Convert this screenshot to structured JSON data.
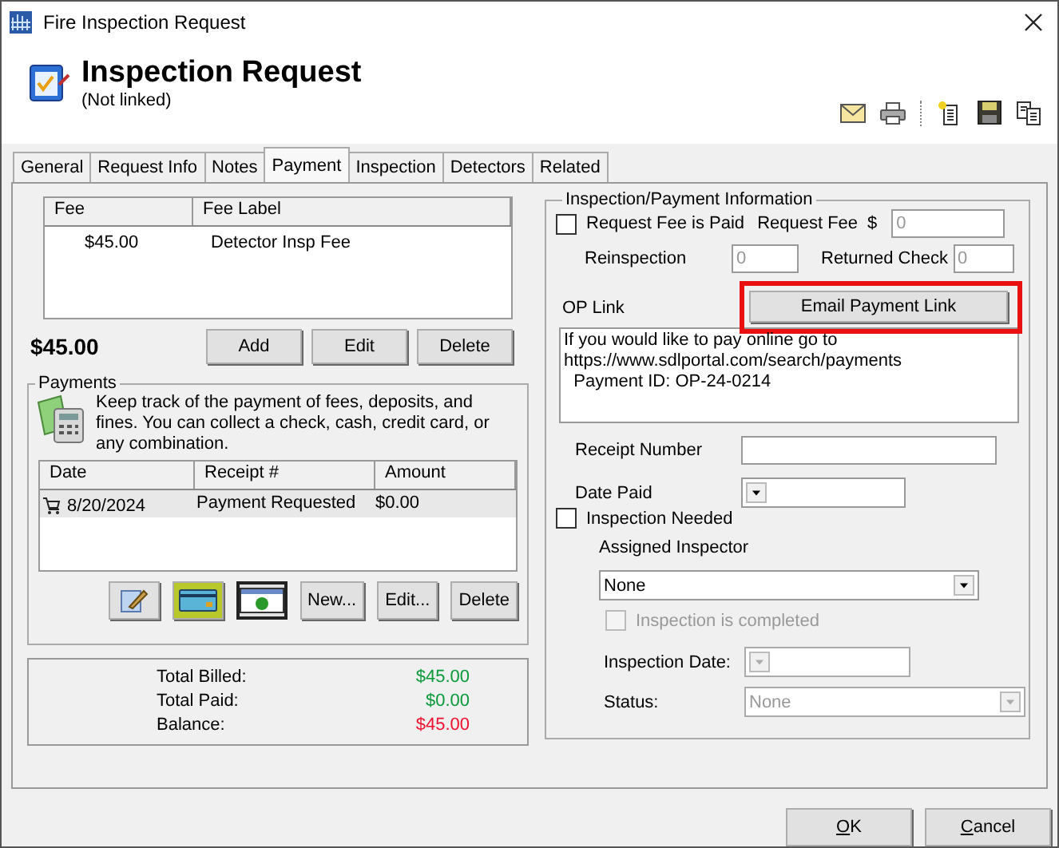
{
  "window": {
    "title": "Fire Inspection Request"
  },
  "header": {
    "title": "Inspection Request",
    "subtitle": "(Not linked)"
  },
  "tabs": [
    {
      "label": "General",
      "selected": false
    },
    {
      "label": "Request Info",
      "selected": false
    },
    {
      "label": "Notes",
      "selected": false
    },
    {
      "label": "Payment",
      "selected": true
    },
    {
      "label": "Inspection",
      "selected": false
    },
    {
      "label": "Detectors",
      "selected": false
    },
    {
      "label": "Related",
      "selected": false
    }
  ],
  "fees": {
    "columns": [
      "Fee",
      "Fee Label"
    ],
    "rows": [
      {
        "fee": "$45.00",
        "label": "Detector Insp Fee"
      }
    ],
    "total": "$45.00",
    "buttons": [
      "Add",
      "Edit",
      "Delete"
    ]
  },
  "payments": {
    "title": "Payments",
    "description": "Keep track of the payment of fees, deposits, and fines. You can collect a check, cash, credit card, or any combination.",
    "columns": [
      "Date",
      "Receipt #",
      "Amount"
    ],
    "rows": [
      {
        "date": "8/20/2024",
        "receipt": "Payment Requested",
        "amount": "$0.00",
        "selected": true
      }
    ],
    "icon_buttons": [
      {
        "kind": "edit",
        "selected": false
      },
      {
        "kind": "card",
        "selected": false
      },
      {
        "kind": "cash",
        "selected": true
      }
    ],
    "buttons": [
      "New...",
      "Edit...",
      "Delete"
    ]
  },
  "totals": [
    {
      "label": "Total Billed:",
      "value": "$45.00",
      "color": "#0a9a3a"
    },
    {
      "label": "Total Paid:",
      "value": "$0.00",
      "color": "#0a9a3a"
    },
    {
      "label": "Balance:",
      "value": "$45.00",
      "color": "#f01030"
    }
  ],
  "info": {
    "title": "Inspection/Payment Information",
    "fee_paid": {
      "label": "Request Fee is Paid",
      "checked": false
    },
    "request_fee": {
      "label": "Request Fee",
      "currency": "$",
      "value": "0",
      "disabled": true
    },
    "reinspection": {
      "label": "Reinspection",
      "value": "0",
      "disabled": true
    },
    "returned_check": {
      "label": "Returned Check",
      "value": "0",
      "disabled": true
    },
    "op_link": {
      "label": "OP Link",
      "text": "If you would like to pay online go to\nhttps://www.sdlportal.com/search/payments\n  Payment ID: OP-24-0214"
    },
    "email_button": {
      "label": "Email Payment Link",
      "highlighted": true
    },
    "receipt_number": {
      "label": "Receipt Number"
    },
    "date_paid": {
      "label": "Date Paid"
    },
    "inspection_needed": {
      "label": "Inspection Needed",
      "checked": false
    },
    "assigned_inspector": {
      "label": "Assigned Inspector",
      "value": "None"
    },
    "inspection_completed": {
      "label": "Inspection is completed",
      "checked": false,
      "disabled": true
    },
    "inspection_date": {
      "label": "Inspection Date:",
      "disabled": true
    },
    "status": {
      "label": "Status:",
      "value": "None",
      "disabled": true
    }
  },
  "footer": [
    {
      "label": "OK"
    },
    {
      "label": "Cancel"
    }
  ]
}
